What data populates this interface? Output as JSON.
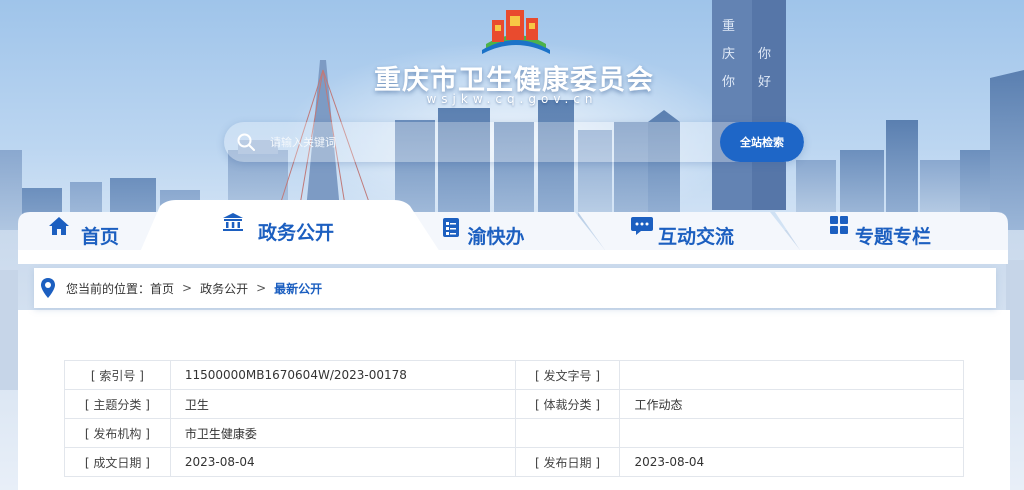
{
  "header": {
    "site_title": "重庆市卫生健康委员会",
    "site_domain": "wsjkw.cq.gov.cn"
  },
  "search": {
    "placeholder": "请输入关键词",
    "button_label": "全站检索"
  },
  "nav": {
    "items": [
      {
        "label": "首页",
        "icon": "home-icon"
      },
      {
        "label": "政务公开",
        "icon": "government-building-icon",
        "active": true
      },
      {
        "label": "渝快办",
        "icon": "service-checklist-icon"
      },
      {
        "label": "互动交流",
        "icon": "chat-bubble-icon"
      },
      {
        "label": "专题专栏",
        "icon": "grid-icon"
      }
    ]
  },
  "breadcrumb": {
    "prefix": "您当前的位置：",
    "items": [
      "首页",
      "政务公开",
      "最新公开"
    ],
    "separator": ">"
  },
  "meta": {
    "rows": [
      {
        "label1": "[ 索引号 ]",
        "value1": "11500000MB1670604W/2023-00178",
        "label2": "[ 发文字号 ]",
        "value2": ""
      },
      {
        "label1": "[ 主题分类 ]",
        "value1": "卫生",
        "label2": "[ 体裁分类 ]",
        "value2": "工作动态"
      },
      {
        "label1": "[ 发布机构 ]",
        "value1": "市卫生健康委",
        "label2": "",
        "value2": ""
      },
      {
        "label1": "[ 成文日期 ]",
        "value1": "2023-08-04",
        "label2": "[ 发布日期 ]",
        "value2": "2023-08-04"
      }
    ]
  },
  "colors": {
    "accent": "#1c5fc0",
    "search_button": "#1e66c7"
  }
}
